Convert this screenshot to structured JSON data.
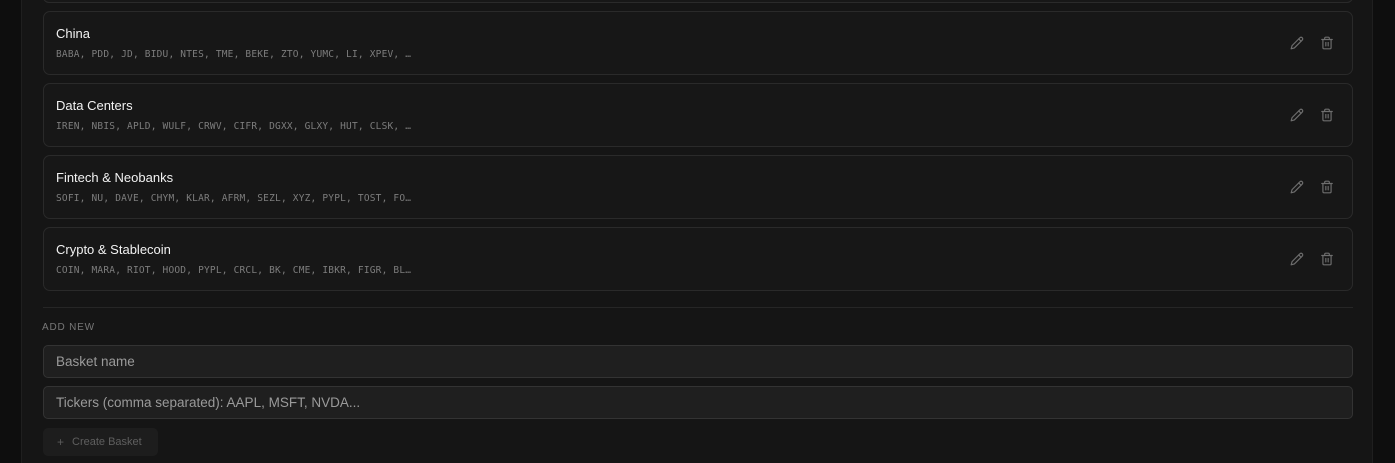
{
  "baskets": [
    {
      "name": "China",
      "tickers": "BABA, PDD, JD, BIDU, NTES, TME, BEKE, ZTO, YUMC, LI, XPEV, …"
    },
    {
      "name": "Data Centers",
      "tickers": "IREN, NBIS, APLD, WULF, CRWV, CIFR, DGXX, GLXY, HUT, CLSK, …"
    },
    {
      "name": "Fintech & Neobanks",
      "tickers": "SOFI, NU, DAVE, CHYM, KLAR, AFRM, SEZL, XYZ, PYPL, TOST, FO…"
    },
    {
      "name": "Crypto & Stablecoin",
      "tickers": "COIN, MARA, RIOT, HOOD, PYPL, CRCL, BK, CME, IBKR, FIGR, BL…"
    }
  ],
  "icons": {
    "edit": "pencil-icon",
    "delete": "trash-icon",
    "add": "plus-icon"
  },
  "add_new": {
    "section_label": "ADD NEW",
    "basket_name_placeholder": "Basket name",
    "tickers_placeholder": "Tickers (comma separated): AAPL, MSFT, NVDA...",
    "create_button_label": "Create Basket"
  },
  "colors": {
    "background": "#0e0e0e",
    "panel": "#151515",
    "card": "#171717",
    "border": "#2a2a2a"
  }
}
